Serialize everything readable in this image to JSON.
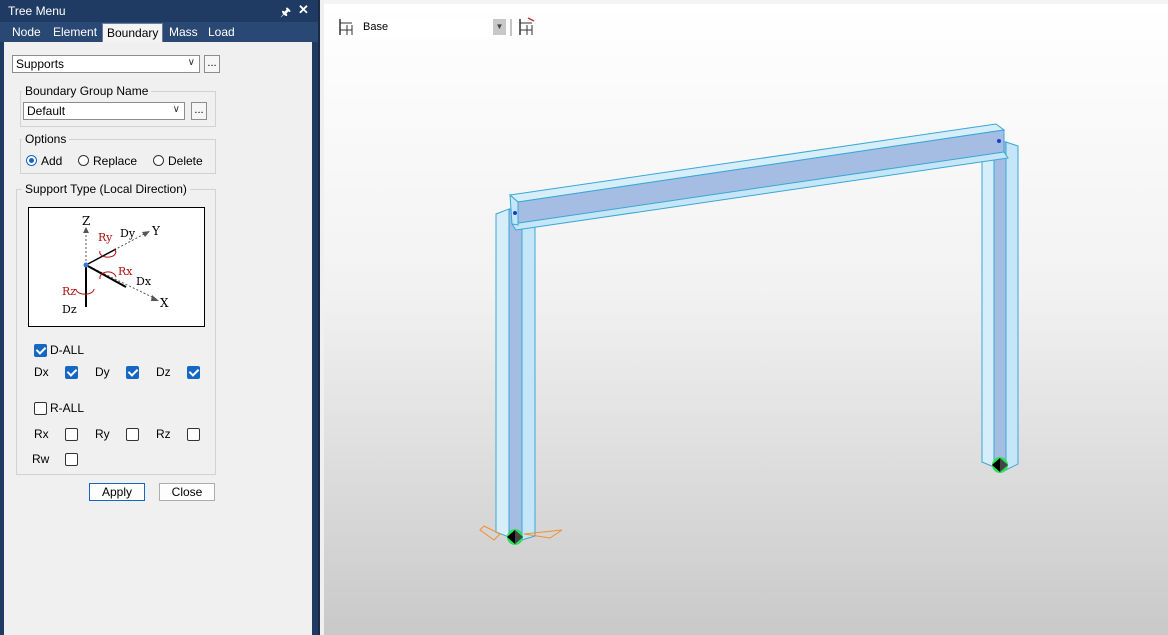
{
  "tree_menu": {
    "title": "Tree Menu",
    "pin_icon": "pin-icon",
    "close_icon": "close-icon",
    "tabs": [
      {
        "label": "Node"
      },
      {
        "label": "Element"
      },
      {
        "label": "Boundary"
      },
      {
        "label": "Mass"
      },
      {
        "label": "Load"
      }
    ],
    "active_tab": "Boundary",
    "function_select": "Supports",
    "more_button": "...",
    "boundary_group": {
      "label": "Boundary Group Name",
      "value": "Default",
      "more_button": "..."
    },
    "options": {
      "label": "Options",
      "items": [
        {
          "label": "Add",
          "selected": true
        },
        {
          "label": "Replace",
          "selected": false
        },
        {
          "label": "Delete",
          "selected": false
        }
      ]
    },
    "support_type": {
      "label": "Support Type (Local Direction)",
      "diagram": {
        "z": "Z",
        "y": "Y",
        "x": "X",
        "ry": "Ry",
        "dy": "Dy",
        "rx": "Rx",
        "dx": "Dx",
        "rz": "Rz",
        "dz": "Dz"
      },
      "d_all": {
        "label": "D-ALL",
        "checked": true
      },
      "d_items": [
        {
          "label": "Dx",
          "checked": true
        },
        {
          "label": "Dy",
          "checked": true
        },
        {
          "label": "Dz",
          "checked": true
        }
      ],
      "r_all": {
        "label": "R-ALL",
        "checked": false
      },
      "r_items": [
        {
          "label": "Rx",
          "checked": false
        },
        {
          "label": "Ry",
          "checked": false
        },
        {
          "label": "Rz",
          "checked": false
        },
        {
          "label": "Rw",
          "checked": false
        }
      ]
    },
    "apply_button": "Apply",
    "close_button": "Close"
  },
  "viewport": {
    "story_select": "Base",
    "colors": {
      "member_fill": "#c5e6f6",
      "member_dark": "#a6bde3",
      "member_edge": "#3aa6d6",
      "support_green": "#2de05a",
      "support_orange": "#f09030"
    }
  }
}
